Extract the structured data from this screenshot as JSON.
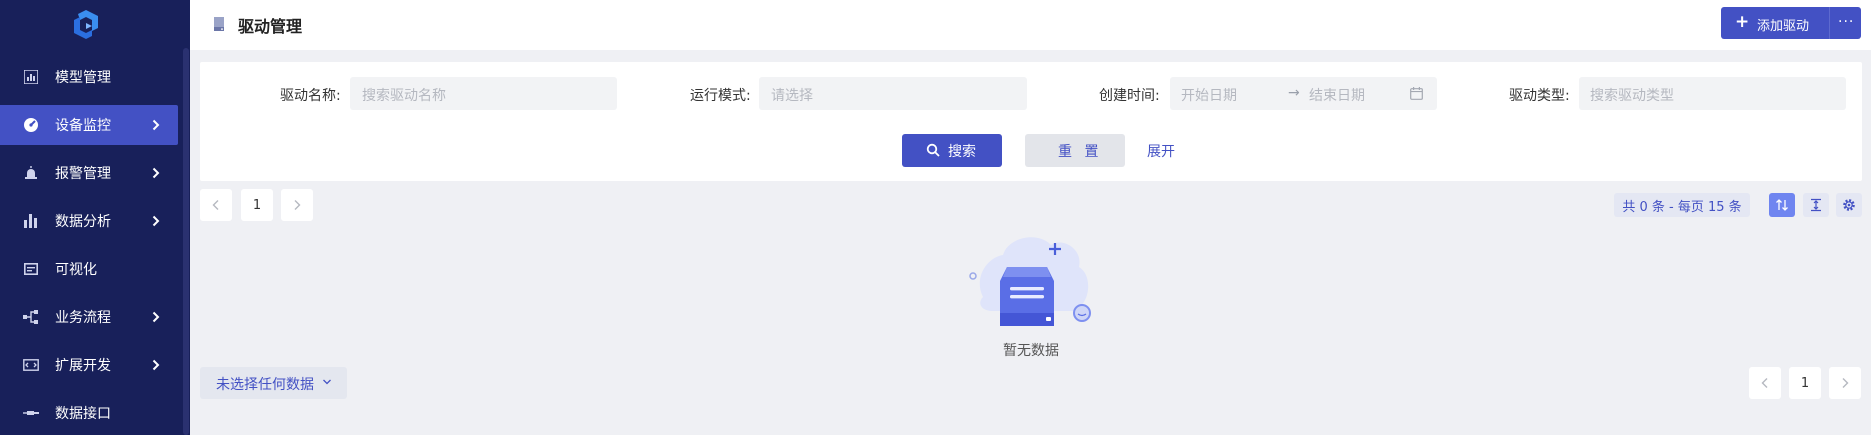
{
  "sidebar": {
    "items": [
      {
        "label": "模型管理",
        "icon": "chart-icon",
        "chevron": false,
        "active": false
      },
      {
        "label": "设备监控",
        "icon": "monitor-icon",
        "chevron": true,
        "active": true
      },
      {
        "label": "报警管理",
        "icon": "alarm-icon",
        "chevron": true,
        "active": false
      },
      {
        "label": "数据分析",
        "icon": "bar-chart-icon",
        "chevron": true,
        "active": false
      },
      {
        "label": "可视化",
        "icon": "screen-icon",
        "chevron": false,
        "active": false
      },
      {
        "label": "业务流程",
        "icon": "flow-icon",
        "chevron": true,
        "active": false
      },
      {
        "label": "扩展开发",
        "icon": "code-icon",
        "chevron": true,
        "active": false
      },
      {
        "label": "数据接口",
        "icon": "plug-icon",
        "chevron": false,
        "active": false
      }
    ]
  },
  "header": {
    "title": "驱动管理",
    "add_button": "添加驱动",
    "more": "···"
  },
  "filters": {
    "driver_name": {
      "label": "驱动名称:",
      "placeholder": "搜索驱动名称"
    },
    "run_mode": {
      "label": "运行模式:",
      "placeholder": "请选择"
    },
    "created_time": {
      "label": "创建时间:",
      "start_placeholder": "开始日期",
      "end_placeholder": "结束日期",
      "separator": "→"
    },
    "driver_type": {
      "label": "驱动类型:",
      "placeholder": "搜索驱动类型"
    },
    "search_button": "搜索",
    "reset_button": "重 置",
    "expand_link": "展开"
  },
  "pagination": {
    "page": "1",
    "total_text": "共 0 条 - 每页 15 条"
  },
  "empty": {
    "text": "暂无数据"
  },
  "selection": {
    "label": "未选择任何数据"
  },
  "colors": {
    "sidebar_bg": "#18205a",
    "accent": "#4351c4",
    "page_bg": "#eff0f4"
  }
}
